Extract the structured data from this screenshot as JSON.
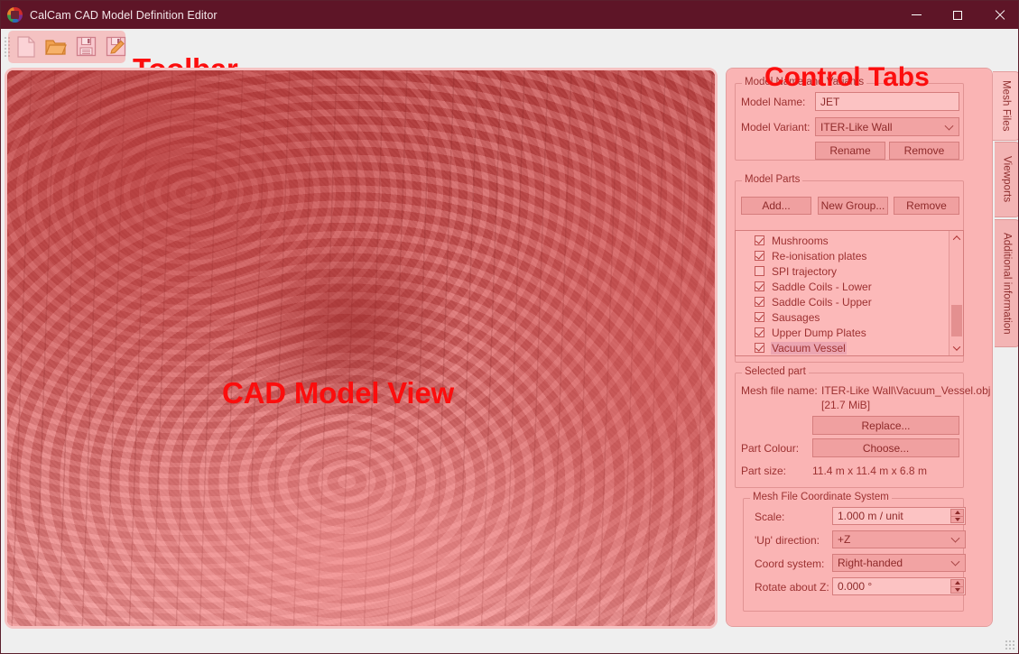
{
  "window": {
    "title": "CalCam CAD Model Definition Editor",
    "app_icon": "calcam-logo-icon",
    "controls": {
      "minimize": "minimize-icon",
      "maximize": "maximize-icon",
      "close": "close-icon"
    }
  },
  "toolbar": {
    "overlay_label": "Toolbar",
    "buttons": [
      {
        "name": "new-file-icon",
        "tooltip": "New"
      },
      {
        "name": "open-folder-icon",
        "tooltip": "Open"
      },
      {
        "name": "save-icon",
        "tooltip": "Save"
      },
      {
        "name": "save-as-icon",
        "tooltip": "Save As"
      }
    ]
  },
  "cad_view": {
    "overlay_label": "CAD Model View"
  },
  "panel": {
    "overlay_label": "Control Tabs",
    "model_name_group": {
      "title": "Model Name and Variants",
      "model_name_label": "Model Name:",
      "model_name_value": "JET",
      "model_variant_label": "Model Variant:",
      "model_variant_value": "ITER-Like Wall",
      "rename_button": "Rename",
      "remove_button": "Remove"
    },
    "model_parts_group": {
      "title": "Model Parts",
      "add_button": "Add...",
      "new_group_button": "New Group...",
      "remove_button": "Remove",
      "items": [
        {
          "label": "Mushrooms",
          "checked": true,
          "selected": false
        },
        {
          "label": "Re-ionisation plates",
          "checked": true,
          "selected": false
        },
        {
          "label": "SPI trajectory",
          "checked": false,
          "selected": false
        },
        {
          "label": "Saddle Coils - Lower",
          "checked": true,
          "selected": false
        },
        {
          "label": "Saddle Coils - Upper",
          "checked": true,
          "selected": false
        },
        {
          "label": "Sausages",
          "checked": true,
          "selected": false
        },
        {
          "label": "Upper Dump Plates",
          "checked": true,
          "selected": false
        },
        {
          "label": "Vacuum Vessel",
          "checked": true,
          "selected": true
        }
      ]
    },
    "selected_part_group": {
      "title": "Selected part",
      "mesh_file_label": "Mesh file name:",
      "mesh_file_value": "ITER-Like Wall\\Vacuum_Vessel.obj",
      "mesh_file_size": "[21.7 MiB]",
      "replace_button": "Replace...",
      "part_colour_label": "Part Colour:",
      "choose_button": "Choose...",
      "part_size_label": "Part size:",
      "part_size_value": "11.4 m x 11.4 m x 6.8 m"
    },
    "coord_group": {
      "title": "Mesh File Coordinate System",
      "scale_label": "Scale:",
      "scale_value": "1.000 m / unit",
      "up_direction_label": "'Up' direction:",
      "up_direction_value": "+Z",
      "coord_system_label": "Coord system:",
      "coord_system_value": "Right-handed",
      "rotate_label": "Rotate about Z:",
      "rotate_value": "0.000 °"
    }
  },
  "tabs": [
    {
      "label": "Mesh Files",
      "active": true
    },
    {
      "label": "Viewports",
      "active": false
    },
    {
      "label": "Additional information",
      "active": false
    }
  ],
  "colors": {
    "titlebar": "#5e1527",
    "overlay_red": "#fc0d0d",
    "panel_pink": "#fac4c4",
    "text_maroon": "#8e2d2d"
  }
}
